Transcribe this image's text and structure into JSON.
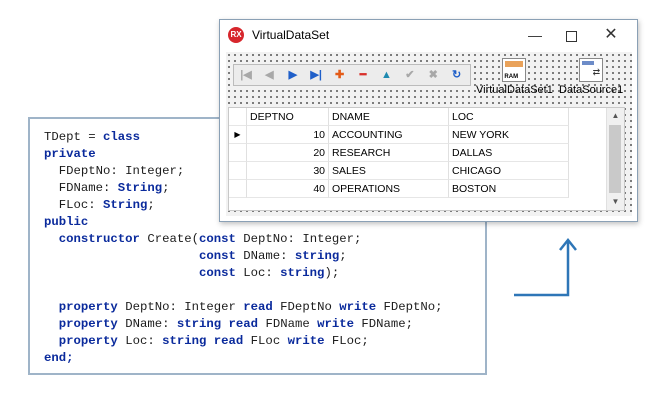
{
  "code": {
    "lines": [
      [
        {
          "t": "TDept = ",
          "k": false
        },
        {
          "t": "class",
          "k": true
        }
      ],
      [
        {
          "t": "private",
          "k": true
        }
      ],
      [
        {
          "t": "  FDeptNo: Integer;",
          "k": false
        }
      ],
      [
        {
          "t": "  FDName: ",
          "k": false
        },
        {
          "t": "String",
          "k": true
        },
        {
          "t": ";",
          "k": false
        }
      ],
      [
        {
          "t": "  FLoc: ",
          "k": false
        },
        {
          "t": "String",
          "k": true
        },
        {
          "t": ";",
          "k": false
        }
      ],
      [
        {
          "t": "public",
          "k": true
        }
      ],
      [
        {
          "t": "  ",
          "k": false
        },
        {
          "t": "constructor",
          "k": true
        },
        {
          "t": " Create(",
          "k": false
        },
        {
          "t": "const",
          "k": true
        },
        {
          "t": " DeptNo: Integer;",
          "k": false
        }
      ],
      [
        {
          "t": "                     ",
          "k": false
        },
        {
          "t": "const",
          "k": true
        },
        {
          "t": " DName: ",
          "k": false
        },
        {
          "t": "string",
          "k": true
        },
        {
          "t": ";",
          "k": false
        }
      ],
      [
        {
          "t": "                     ",
          "k": false
        },
        {
          "t": "const",
          "k": true
        },
        {
          "t": " Loc: ",
          "k": false
        },
        {
          "t": "string",
          "k": true
        },
        {
          "t": ");",
          "k": false
        }
      ],
      [
        {
          "t": "",
          "k": false
        }
      ],
      [
        {
          "t": "  ",
          "k": false
        },
        {
          "t": "property",
          "k": true
        },
        {
          "t": " DeptNo: Integer ",
          "k": false
        },
        {
          "t": "read",
          "k": true
        },
        {
          "t": " FDeptNo ",
          "k": false
        },
        {
          "t": "write",
          "k": true
        },
        {
          "t": " FDeptNo;",
          "k": false
        }
      ],
      [
        {
          "t": "  ",
          "k": false
        },
        {
          "t": "property",
          "k": true
        },
        {
          "t": " DName: ",
          "k": false
        },
        {
          "t": "string",
          "k": true
        },
        {
          "t": " ",
          "k": false
        },
        {
          "t": "read",
          "k": true
        },
        {
          "t": " FDName ",
          "k": false
        },
        {
          "t": "write",
          "k": true
        },
        {
          "t": " FDName;",
          "k": false
        }
      ],
      [
        {
          "t": "  ",
          "k": false
        },
        {
          "t": "property",
          "k": true
        },
        {
          "t": " Loc: ",
          "k": false
        },
        {
          "t": "string",
          "k": true
        },
        {
          "t": " ",
          "k": false
        },
        {
          "t": "read",
          "k": true
        },
        {
          "t": " FLoc ",
          "k": false
        },
        {
          "t": "write",
          "k": true
        },
        {
          "t": " FLoc;",
          "k": false
        }
      ],
      [
        {
          "t": "end;",
          "k": true
        }
      ]
    ],
    "keyword_color": "#0a2a9c"
  },
  "window": {
    "title": "VirtualDataSet",
    "app_icon_text": "RX",
    "minimize_icon": "minimize-icon",
    "maximize_icon": "maximize-icon",
    "close_icon": "close-icon"
  },
  "navigator": {
    "buttons": [
      {
        "name": "first-record-button",
        "glyph": "|◀",
        "state": "disabled"
      },
      {
        "name": "prior-record-button",
        "glyph": "◀",
        "state": "disabled"
      },
      {
        "name": "next-record-button",
        "glyph": "▶",
        "state": "blue"
      },
      {
        "name": "last-record-button",
        "glyph": "▶|",
        "state": "blue"
      },
      {
        "name": "insert-record-button",
        "glyph": "✚",
        "state": "orange"
      },
      {
        "name": "delete-record-button",
        "glyph": "━",
        "state": "red"
      },
      {
        "name": "edit-record-button",
        "glyph": "▲",
        "state": "teal"
      },
      {
        "name": "post-edit-button",
        "glyph": "✔",
        "state": "disabled"
      },
      {
        "name": "cancel-edit-button",
        "glyph": "✖",
        "state": "disabled"
      },
      {
        "name": "refresh-data-button",
        "glyph": "↻",
        "state": "blue"
      }
    ]
  },
  "components": {
    "virtual_dataset_label": "VirtualDataSet1",
    "datasource_label": "DataSource1",
    "ram_icon_text": "RAM"
  },
  "grid": {
    "columns": [
      "DEPTNO",
      "DNAME",
      "LOC"
    ],
    "rows": [
      {
        "deptno": "10",
        "dname": "ACCOUNTING",
        "loc": "NEW YORK",
        "current": true
      },
      {
        "deptno": "20",
        "dname": "RESEARCH",
        "loc": "DALLAS",
        "current": false
      },
      {
        "deptno": "30",
        "dname": "SALES",
        "loc": "CHICAGO",
        "current": false
      },
      {
        "deptno": "40",
        "dname": "OPERATIONS",
        "loc": "BOSTON",
        "current": false
      }
    ],
    "current_row_indicator": "▶"
  },
  "colors": {
    "arrow": "#2e76b7",
    "panel_border": "#9fb4c8"
  }
}
